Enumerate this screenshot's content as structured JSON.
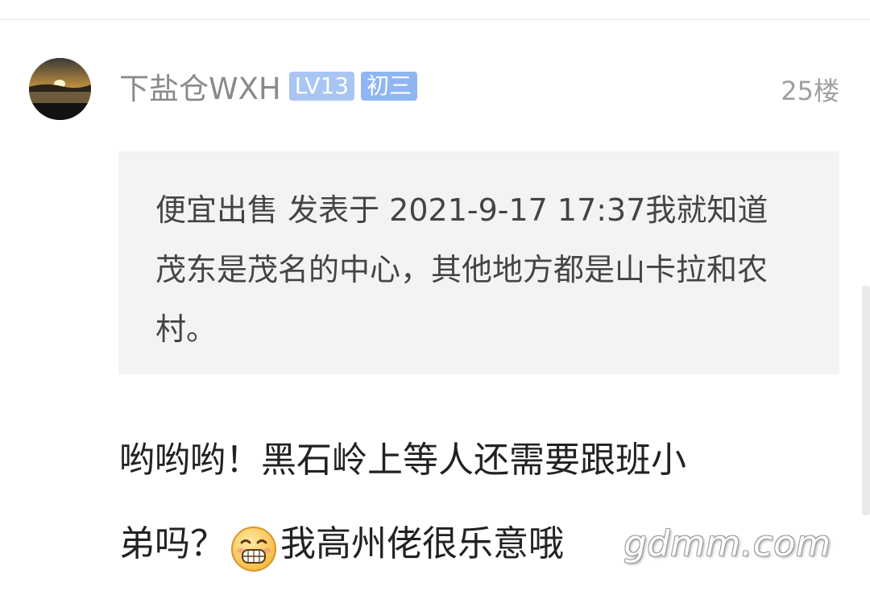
{
  "post": {
    "username": "下盐仓WXH",
    "level_badge": "LV13",
    "title_badge": "初三",
    "floor": "25楼",
    "quote": "便宜出售 发表于 2021-9-17 17:37我就知道茂东是茂名的中心，其他地方都是山卡拉和农村。",
    "content_line1": "哟哟哟！黑石岭上等人还需要跟班小",
    "content_line2_before": "弟吗？",
    "content_emoji": "grinning-face-emoji",
    "content_line2_after": "我高州佬很乐意哦"
  },
  "watermark": "gdmm.com",
  "colors": {
    "badge_level": "#a9c5f2",
    "badge_title": "#8fb6f3",
    "quote_background": "#f3f3f3",
    "username": "#8a8a8a"
  },
  "icons": {
    "avatar": "sunset-avatar",
    "emoji": "grinning-face-emoji"
  }
}
